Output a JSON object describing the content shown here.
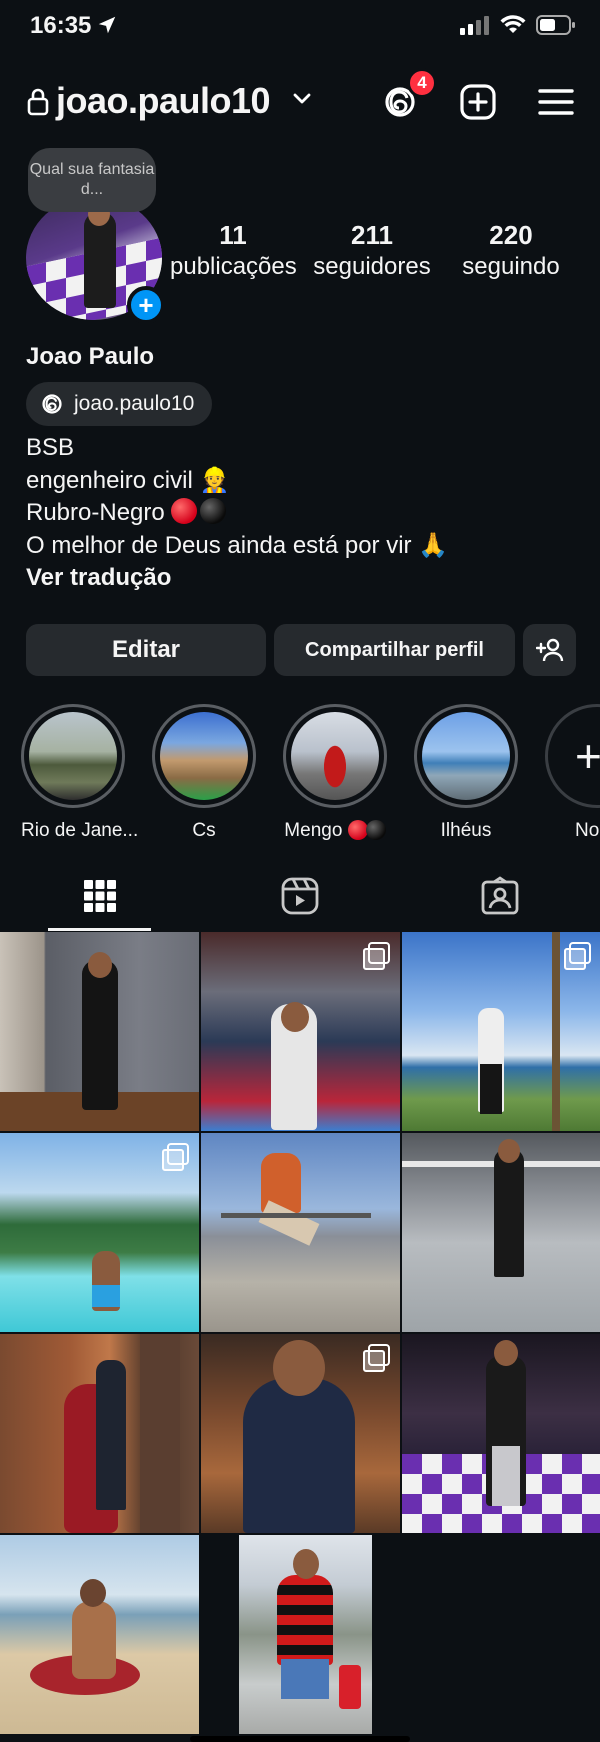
{
  "status_bar": {
    "time": "16:35"
  },
  "header": {
    "username": "joao.paulo10",
    "notification_count": "4"
  },
  "note": {
    "text": "Qual sua fantasia d..."
  },
  "stats": [
    {
      "value": "11",
      "label": "publicações"
    },
    {
      "value": "211",
      "label": "seguidores"
    },
    {
      "value": "220",
      "label": "seguindo"
    }
  ],
  "profile": {
    "full_name": "Joao Paulo",
    "threads_handle": "joao.paulo10",
    "bio": [
      "BSB",
      "engenheiro civil",
      "Rubro-Negro",
      "O melhor de Deus ainda está por vir"
    ],
    "translate_label": "Ver tradução"
  },
  "buttons": {
    "edit": "Editar",
    "share": "Compartilhar perfil"
  },
  "highlights": [
    {
      "label": "Rio de Jane..."
    },
    {
      "label": "Cs"
    },
    {
      "label": "Mengo"
    },
    {
      "label": "Ilhéus"
    },
    {
      "label": "No"
    }
  ],
  "tabs": [
    "grid-tab",
    "reels-tab",
    "tagged-tab"
  ],
  "colors": {
    "accent": "#0095f6",
    "badge": "#ff3040",
    "background": "#0c1014",
    "button": "#262a2e"
  },
  "posts_count": 11
}
